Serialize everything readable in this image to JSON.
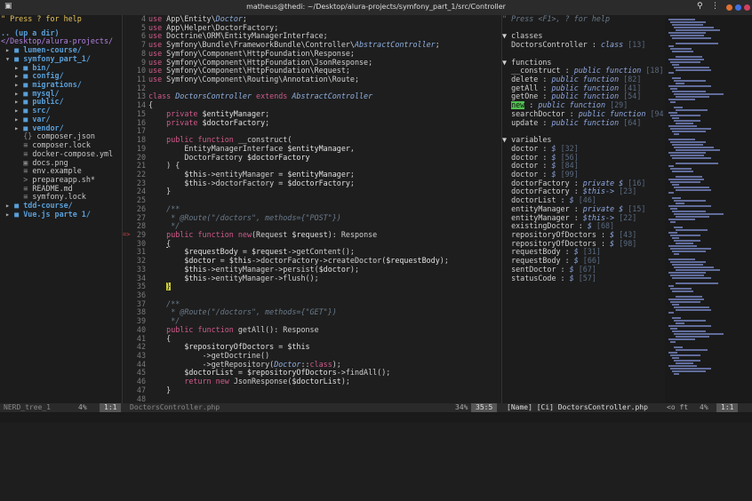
{
  "window": {
    "title": "matheus@thedi: ~/Desktop/alura-projects/symfony_part_1/src/Controller"
  },
  "tree": {
    "help": "\" Press ? for help",
    "up": ".. (up a dir)",
    "root": "</Desktop/alura-projects/",
    "items": [
      {
        "indent": 0,
        "arrow": "▸",
        "icon": "■",
        "text": "lumen-course/",
        "type": "dir"
      },
      {
        "indent": 0,
        "arrow": "▾",
        "icon": "■",
        "text": "symfony_part_1/",
        "type": "dir"
      },
      {
        "indent": 1,
        "arrow": "▸",
        "icon": "■",
        "text": "bin/",
        "type": "dir"
      },
      {
        "indent": 1,
        "arrow": "▸",
        "icon": "■",
        "text": "config/",
        "type": "dir"
      },
      {
        "indent": 1,
        "arrow": "▸",
        "icon": "■",
        "text": "migrations/",
        "type": "dir"
      },
      {
        "indent": 1,
        "arrow": "▸",
        "icon": "■",
        "text": "mysql/",
        "type": "dir"
      },
      {
        "indent": 1,
        "arrow": "▸",
        "icon": "■",
        "text": "public/",
        "type": "dir"
      },
      {
        "indent": 1,
        "arrow": "▸",
        "icon": "■",
        "text": "src/",
        "type": "dir"
      },
      {
        "indent": 1,
        "arrow": "▸",
        "icon": "■",
        "text": "var/",
        "type": "dir"
      },
      {
        "indent": 1,
        "arrow": "▸",
        "icon": "■",
        "text": "vendor/",
        "type": "dir"
      },
      {
        "indent": 1,
        "arrow": " ",
        "icon": "{}",
        "text": "composer.json",
        "type": "file"
      },
      {
        "indent": 1,
        "arrow": " ",
        "icon": "≡",
        "text": "composer.lock",
        "type": "file"
      },
      {
        "indent": 1,
        "arrow": " ",
        "icon": "≡",
        "text": "docker-compose.yml",
        "type": "file"
      },
      {
        "indent": 1,
        "arrow": " ",
        "icon": "▣",
        "text": "docs.png",
        "type": "file"
      },
      {
        "indent": 1,
        "arrow": " ",
        "icon": "≡",
        "text": "env.example",
        "type": "file"
      },
      {
        "indent": 1,
        "arrow": " ",
        "icon": ">",
        "text": "prepareapp.sh*",
        "type": "file"
      },
      {
        "indent": 1,
        "arrow": " ",
        "icon": "≡",
        "text": "README.md",
        "type": "file"
      },
      {
        "indent": 1,
        "arrow": " ",
        "icon": "≡",
        "text": "symfony.lock",
        "type": "file"
      },
      {
        "indent": 0,
        "arrow": "▸",
        "icon": "■",
        "text": "tdd-course/",
        "type": "dir"
      },
      {
        "indent": 0,
        "arrow": "▸",
        "icon": "■",
        "text": "Vue.js parte 1/",
        "type": "dir"
      }
    ]
  },
  "code": [
    {
      "n": "4",
      "t": "use App\\Entity\\Doctor;"
    },
    {
      "n": "5",
      "t": "use App\\Helper\\DoctorFactory;"
    },
    {
      "n": "6",
      "t": "use Doctrine\\ORM\\EntityManagerInterface;"
    },
    {
      "n": "7",
      "t": "use Symfony\\Bundle\\FrameworkBundle\\Controller\\AbstractController;"
    },
    {
      "n": "8",
      "t": "use Symfony\\Component\\HttpFoundation\\Response;"
    },
    {
      "n": "9",
      "t": "use Symfony\\Component\\HttpFoundation\\JsonResponse;"
    },
    {
      "n": "10",
      "t": "use Symfony\\Component\\HttpFoundation\\Request;"
    },
    {
      "n": "11",
      "t": "use Symfony\\Component\\Routing\\Annotation\\Route;"
    },
    {
      "n": "12",
      "t": ""
    },
    {
      "n": "13",
      "t": "class DoctorsController extends AbstractController"
    },
    {
      "n": "14",
      "t": "{"
    },
    {
      "n": "15",
      "t": "    private $entityManager;"
    },
    {
      "n": "16",
      "t": "    private $doctorFactory;"
    },
    {
      "n": "17",
      "t": ""
    },
    {
      "n": "18",
      "t": "    public function __construct("
    },
    {
      "n": "19",
      "t": "        EntityManagerInterface $entityManager,"
    },
    {
      "n": "20",
      "t": "        DoctorFactory $doctorFactory"
    },
    {
      "n": "21",
      "t": "    ) {"
    },
    {
      "n": "22",
      "t": "        $this->entityManager = $entityManager;"
    },
    {
      "n": "23",
      "t": "        $this->doctorFactory = $doctorFactory;"
    },
    {
      "n": "24",
      "t": "    }"
    },
    {
      "n": "25",
      "t": ""
    },
    {
      "n": "26",
      "t": "    /**"
    },
    {
      "n": "27",
      "t": "     * @Route(\"/doctors\", methods={\"POST\"})"
    },
    {
      "n": "28",
      "t": "     */"
    },
    {
      "n": "29",
      "t": "    public function new(Request $request): Response",
      "sign": "=>"
    },
    {
      "n": "30",
      "t": "    {"
    },
    {
      "n": "31",
      "t": "        $requestBody = $request->getContent();"
    },
    {
      "n": "32",
      "t": "        $doctor = $this->doctorFactory->createDoctor($requestBody);"
    },
    {
      "n": "33",
      "t": "        $this->entityManager->persist($doctor);"
    },
    {
      "n": "34",
      "t": "        $this->entityManager->flush();"
    },
    {
      "n": "35",
      "t": "    }"
    },
    {
      "n": "36",
      "t": ""
    },
    {
      "n": "37",
      "t": "    /**"
    },
    {
      "n": "38",
      "t": "     * @Route(\"/doctors\", methods={\"GET\"})"
    },
    {
      "n": "39",
      "t": "     */"
    },
    {
      "n": "40",
      "t": "    public function getAll(): Response"
    },
    {
      "n": "41",
      "t": "    {"
    },
    {
      "n": "42",
      "t": "        $repositoryOfDoctors = $this"
    },
    {
      "n": "43",
      "t": "            ->getDoctrine()"
    },
    {
      "n": "44",
      "t": "            ->getRepository(Doctor::class);"
    },
    {
      "n": "45",
      "t": "        $doctorList = $repositoryOfDoctors->findAll();"
    },
    {
      "n": "46",
      "t": "        return new JsonResponse($doctorList);"
    },
    {
      "n": "47",
      "t": "    }"
    },
    {
      "n": "48",
      "t": ""
    }
  ],
  "tags": {
    "help": "\" Press <F1>, ? for help",
    "classes_title": "classes",
    "classes": [
      {
        "name": "DoctorsController",
        "kind": "class",
        "line": "[13]"
      }
    ],
    "functions_title": "functions",
    "functions": [
      {
        "name": "__construct",
        "kind": "public function",
        "line": "[18]"
      },
      {
        "name": "delete",
        "kind": "public function",
        "line": "[82]"
      },
      {
        "name": "getAll",
        "kind": "public function",
        "line": "[41]"
      },
      {
        "name": "getOne",
        "kind": "public function",
        "line": "[54]"
      },
      {
        "name": "new",
        "kind": "public function",
        "line": "[29]",
        "hl": true
      },
      {
        "name": "searchDoctor",
        "kind": "public function",
        "line": "[94]"
      },
      {
        "name": "update",
        "kind": "public function",
        "line": "[64]"
      }
    ],
    "variables_title": "variables",
    "variables": [
      {
        "name": "doctor",
        "kind": "$",
        "line": "[32]"
      },
      {
        "name": "doctor",
        "kind": "$",
        "line": "[56]"
      },
      {
        "name": "doctor",
        "kind": "$",
        "line": "[84]"
      },
      {
        "name": "doctor",
        "kind": "$",
        "line": "[99]"
      },
      {
        "name": "doctorFactory",
        "kind": "private $",
        "line": "[16]"
      },
      {
        "name": "doctorFactory",
        "kind": "$this->",
        "line": "[23]"
      },
      {
        "name": "doctorList",
        "kind": "$",
        "line": "[46]"
      },
      {
        "name": "entityManager",
        "kind": "private $",
        "line": "[15]"
      },
      {
        "name": "entityManager",
        "kind": "$this->",
        "line": "[22]"
      },
      {
        "name": "existingDoctor",
        "kind": "$",
        "line": "[68]"
      },
      {
        "name": "repositoryOfDoctors",
        "kind": "$",
        "line": "[43]"
      },
      {
        "name": "repositoryOfDoctors",
        "kind": "$",
        "line": "[98]"
      },
      {
        "name": "requestBody",
        "kind": "$",
        "line": "[31]"
      },
      {
        "name": "requestBody",
        "kind": "$",
        "line": "[66]"
      },
      {
        "name": "sentDoctor",
        "kind": "$",
        "line": "[67]"
      },
      {
        "name": "statusCode",
        "kind": "$",
        "line": "[57]"
      }
    ]
  },
  "statusbar": {
    "tree_name": "NERD_tree_1",
    "tree_pct": "4%",
    "tree_pos": "1:1",
    "code_file": "DoctorsController.php",
    "code_pct": "34%",
    "code_pos": "35:5",
    "tags_file": "[Name] [Ci] DoctorsController.php",
    "tags_misc": "<o ft",
    "tags_pct": "4%",
    "tags_pos": "1:1"
  }
}
